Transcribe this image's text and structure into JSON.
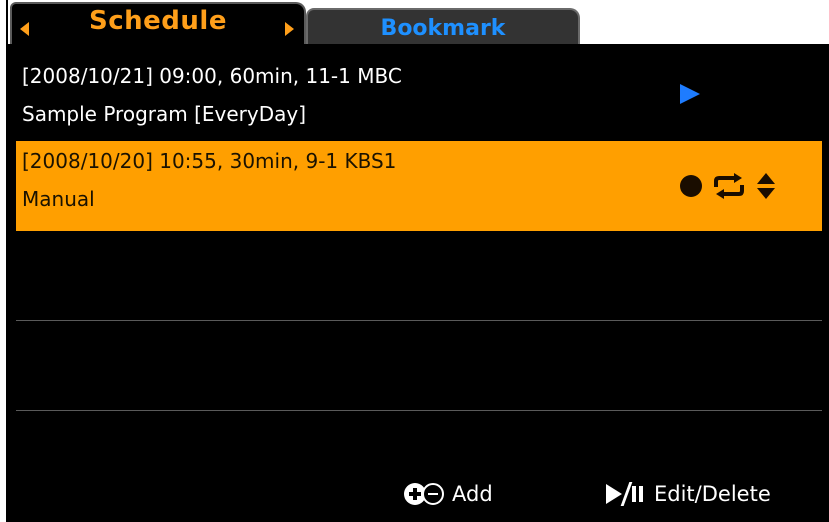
{
  "tabs": {
    "schedule_label": "Schedule",
    "bookmark_label": "Bookmark",
    "active": "Schedule"
  },
  "schedule_items": [
    {
      "line1": "[2008/10/21] 09:00, 60min, 11-1 MBC",
      "line2": "Sample Program [EveryDay]",
      "icon": "play-icon",
      "selected": false
    },
    {
      "line1": "[2008/10/20] 10:55, 30min, 9-1 KBS1",
      "line2": "Manual",
      "icons": [
        "record-dot-icon",
        "repeat-icon",
        "up-down-arrows-icon"
      ],
      "selected": true
    },
    {
      "line1": "",
      "line2": ""
    },
    {
      "line1": "",
      "line2": ""
    }
  ],
  "footer": {
    "add_label": "Add",
    "edit_delete_label": "Edit/Delete"
  },
  "colors": {
    "accent_orange": "#ff9f00",
    "bookmark_blue": "#1e90ff",
    "play_blue": "#1e7cff",
    "background": "#000000"
  }
}
